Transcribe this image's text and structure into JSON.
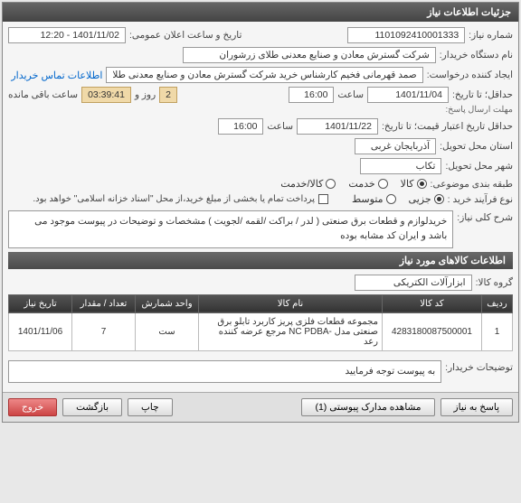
{
  "header": {
    "title": "جزئیات اطلاعات نیاز"
  },
  "fields": {
    "need_number_label": "شماره نیاز:",
    "need_number": "1101092410001333",
    "announce_label": "تاریخ و ساعت اعلان عمومی:",
    "announce_value": "1401/11/02 - 12:20",
    "buyer_label": "نام دستگاه خریدار:",
    "buyer_value": "شرکت گسترش معادن و صنایع معدنی طلای زرشوران",
    "creator_label": "ایجاد کننده درخواست:",
    "creator_value": "صمد قهرمانی فخیم کارشناس خرید شرکت گسترش معادن و صنایع معدنی طلا",
    "contact_link": "اطلاعات تماس خریدار",
    "deadline_label": "مهلت ارسال پاسخ:",
    "deadline_prefix": "حداقل؛ تا تاریخ:",
    "deadline_date": "1401/11/04",
    "time_label": "ساعت",
    "deadline_time": "16:00",
    "day_label": "روز و",
    "days_remain": "2",
    "countdown": "03:39:41",
    "remain_label": "ساعت باقی مانده",
    "validity_label": "حداقل تاریخ اعتبار قیمت؛ تا تاریخ:",
    "validity_date": "1401/11/22",
    "validity_time": "16:00",
    "province_label": "استان محل تحویل:",
    "province_value": "آذربایجان غربی",
    "city_label": "شهر محل تحویل:",
    "city_value": "تکاب",
    "category_label": "طبقه بندی موضوعی:",
    "cat_goods": "کالا",
    "cat_service": "خدمت",
    "cat_goods_service": "کالا/خدمت",
    "buy_type_label": "نوع فرآیند خرید :",
    "bt_partial": "جزیی",
    "bt_medium": "متوسط",
    "partial_pay_label": "پرداخت تمام یا بخشی از مبلغ خرید،از محل \"اسناد خزانه اسلامی\" خواهد بود.",
    "desc_label": "شرح کلی نیاز:",
    "desc_value": "خریدلوازم و قطعات برق صنعتی ( لدر / براکت /لقمه /لجویت ) مشخصات و توضیحات در پیوست موجود می باشد و ایران کد مشابه بوده"
  },
  "items_header": "اطلاعات کالاهای مورد نیاز",
  "group_label": "گروه کالا:",
  "group_value": "ابزارآلات الکتریکی",
  "table": {
    "headers": {
      "row": "ردیف",
      "code": "کد کالا",
      "name": "نام کالا",
      "unit": "واحد شمارش",
      "qty": "تعداد / مقدار",
      "date": "تاریخ نیاز"
    },
    "rows": [
      {
        "row": "1",
        "code": "4283180087500001",
        "name": "مجموعه قطعات فلزی پریز کاربرد تابلو برق صنعتی مدل -NC PDBA مرجع عرضه کننده رعد",
        "unit": "ست",
        "qty": "7",
        "date": "1401/11/06"
      }
    ]
  },
  "buyer_notes_label": "توضیحات خریدار:",
  "buyer_notes": "به پیوست توجه فرمایید",
  "buttons": {
    "reply": "پاسخ به نیاز",
    "attachments": "مشاهده مدارک پیوستی (1)",
    "print": "چاپ",
    "back": "بازگشت",
    "exit": "خروج"
  }
}
